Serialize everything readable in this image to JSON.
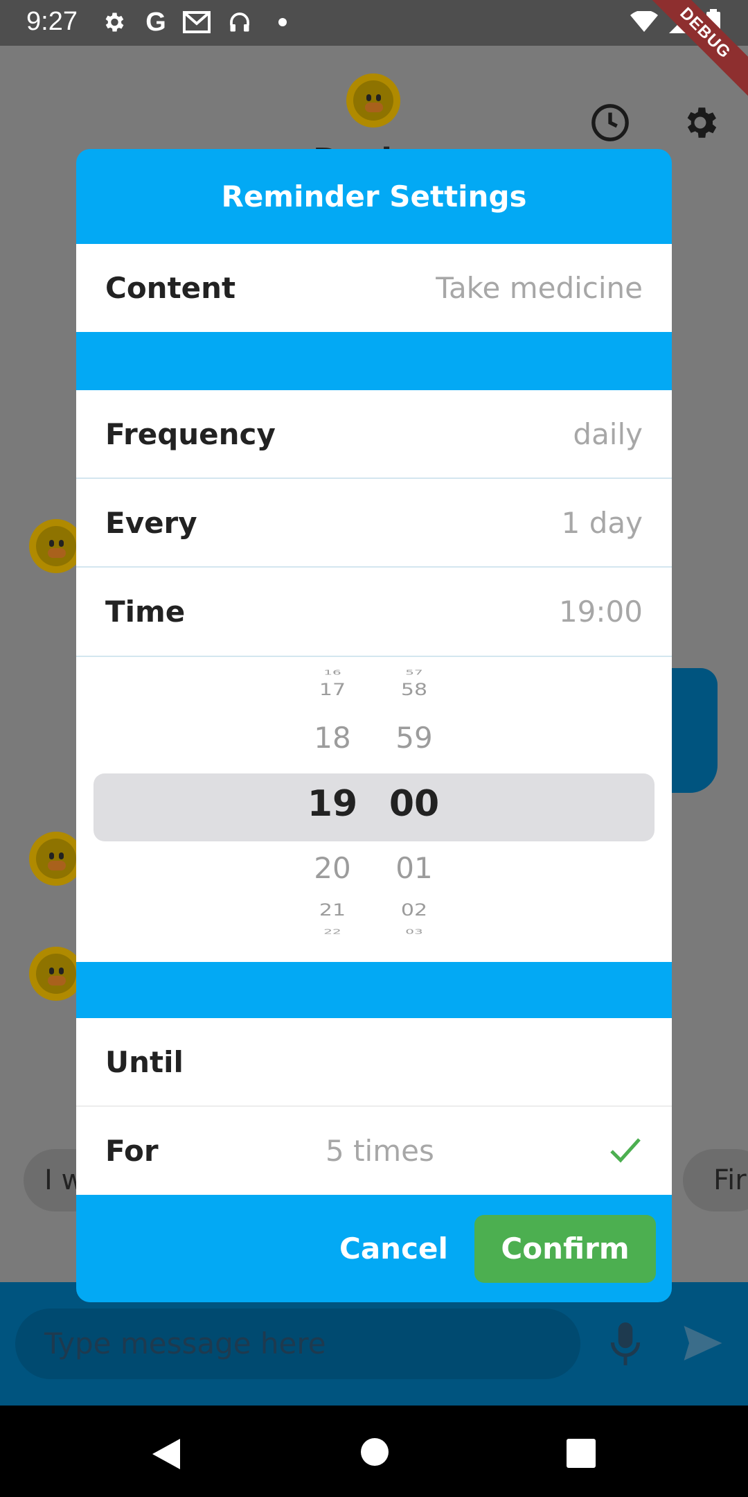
{
  "status_bar": {
    "time": "9:27",
    "debug_label": "DEBUG"
  },
  "background": {
    "title": "Duck",
    "message_placeholder": "Type message here",
    "chips": [
      "I w",
      "Fir"
    ]
  },
  "dialog": {
    "title": "Reminder Settings",
    "content": {
      "label": "Content",
      "value": "Take medicine"
    },
    "frequency": {
      "label": "Frequency",
      "value": "daily"
    },
    "every": {
      "label": "Every",
      "value": "1 day"
    },
    "time": {
      "label": "Time",
      "value": "19:00"
    },
    "picker": {
      "hours": [
        "16",
        "17",
        "18",
        "19",
        "20",
        "21",
        "22"
      ],
      "minutes": [
        "57",
        "58",
        "59",
        "00",
        "01",
        "02",
        "03"
      ],
      "selected_hour": "19",
      "selected_minute": "00"
    },
    "until": {
      "label": "Until",
      "value": ""
    },
    "for": {
      "label": "For",
      "value": "5 times",
      "checked": true
    },
    "buttons": {
      "cancel": "Cancel",
      "confirm": "Confirm"
    }
  },
  "colors": {
    "dialog_blue": "#03a9f4",
    "confirm_green": "#4caf50",
    "check_green": "#4caf50",
    "value_grey": "#a7a7a7"
  }
}
